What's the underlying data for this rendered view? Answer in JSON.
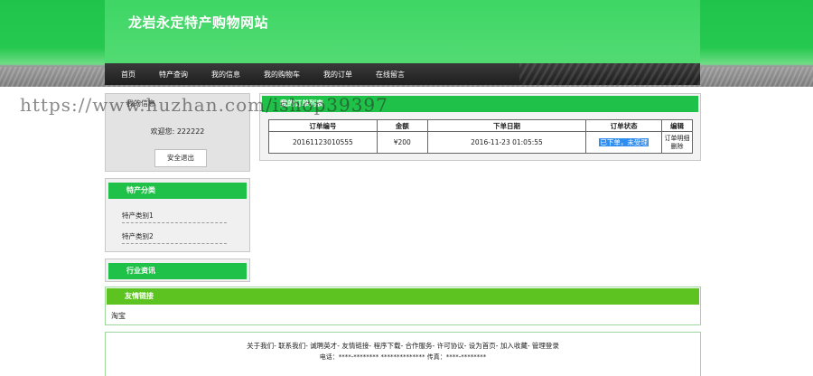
{
  "site": {
    "title": "龙岩永定特产购物网站"
  },
  "nav": {
    "items": [
      "首页",
      "特产查询",
      "我的信息",
      "我的购物车",
      "我的订单",
      "在线留言"
    ]
  },
  "watermark": "https://www.huzhan.com/ishop39397",
  "user_panel": {
    "title": "我的信息",
    "welcome": "欢迎您: 222222",
    "logout_label": "安全退出"
  },
  "category_panel": {
    "title": "特产分类",
    "items": [
      "特产类别1",
      "特产类别2"
    ]
  },
  "news_panel": {
    "title": "行业资讯"
  },
  "orders": {
    "title": "我的订单列表",
    "columns": [
      "订单编号",
      "金额",
      "下单日期",
      "订单状态",
      "编辑"
    ],
    "rows": [
      {
        "order_no": "20161123010555",
        "amount": "¥200",
        "date": "2016-11-23 01:05:55",
        "status": "已下单，未受理",
        "action_detail": "订单明细",
        "action_delete": "删除"
      }
    ]
  },
  "friend_links": {
    "title": "友情链接",
    "items": [
      "淘宝"
    ]
  },
  "footer": {
    "links": [
      "关于我们",
      "联系我们",
      "诚聘英才",
      "友情链接",
      "程序下载",
      "合作服务",
      "许可协议",
      "设为首页",
      "加入收藏",
      "管理登录"
    ],
    "contact": "电话：****-******** ************** 传真：****-********"
  },
  "colors": {
    "brand_green": "#1fc148",
    "header_green": "#4ad96d",
    "links_green": "#5cc320",
    "nav_dark": "#2a2a2a",
    "status_highlight": "#2f8ef0"
  }
}
